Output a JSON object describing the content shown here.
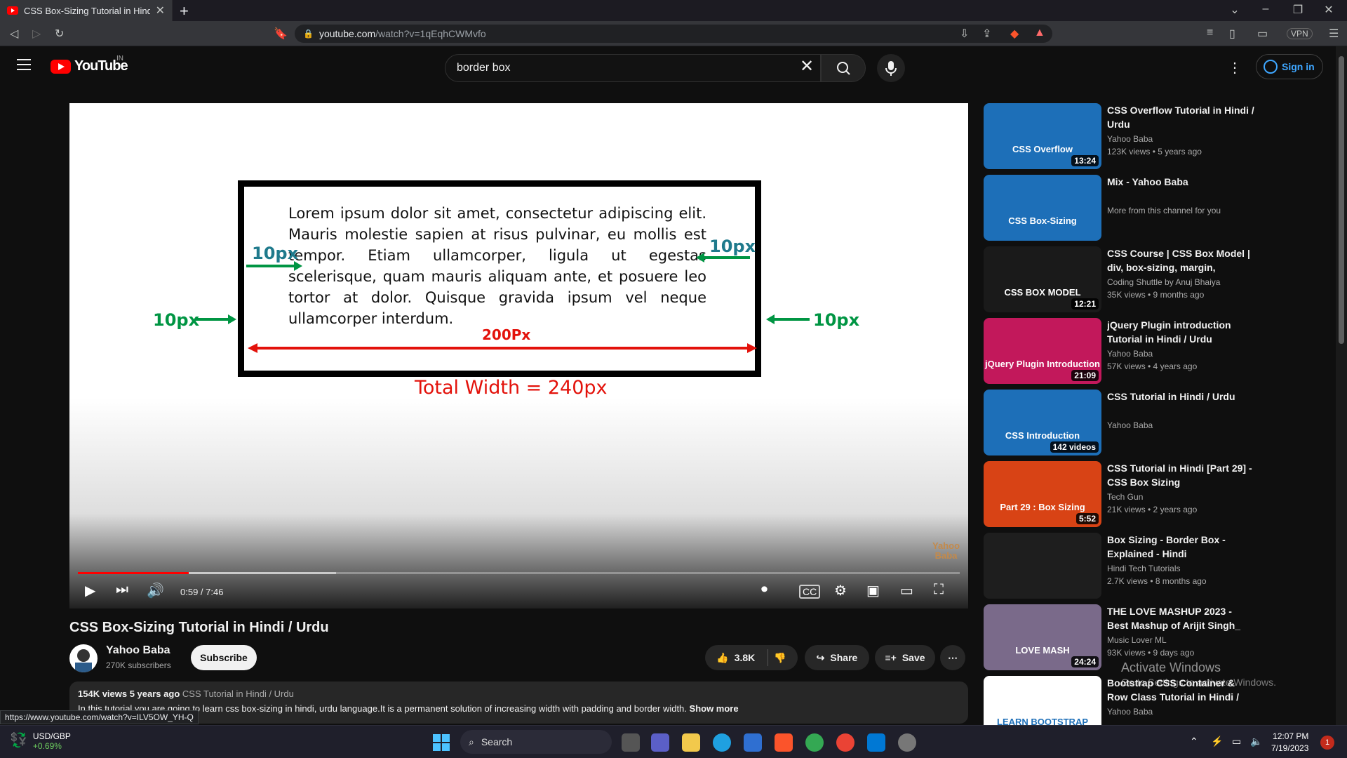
{
  "browser": {
    "tab_title": "CSS Box-Sizing Tutorial in Hindi /",
    "url_host": "youtube.com",
    "url_path": "/watch?v=1qEqhCWMvfo",
    "vpn_label": "VPN",
    "status_url": "https://www.youtube.com/watch?v=ILV5OW_YH-Q"
  },
  "header": {
    "logo_text": "YouTube",
    "country": "IN",
    "search_value": "border box",
    "sign_in": "Sign in"
  },
  "video": {
    "slide": {
      "lorem": "Lorem ipsum dolor sit amet, consectetur adipiscing elit. Mauris molestie sapien at risus pulvinar, eu mollis est tempor. Etiam ullamcorper, ligula ut egestas scelerisque, quam mauris aliquam ante, et posuere leo tortor at dolor. Quisque gravida ipsum vel neque ullamcorper interdum.",
      "label_padding_left": "10px",
      "label_padding_right": "10px",
      "label_border_left": "10px",
      "label_border_right": "10px",
      "label_width": "200Px",
      "total_width": "Total Width = 240px",
      "watermark_1": "Yahoo",
      "watermark_2": "Baba"
    },
    "time": "0:59 / 7:46",
    "progress_played": 0.126,
    "progress_buffered": 0.293,
    "title": "CSS Box-Sizing Tutorial in Hindi / Urdu",
    "channel": "Yahoo Baba",
    "subscribers": "270K subscribers",
    "subscribe_label": "Subscribe",
    "likes": "3.8K",
    "share_label": "Share",
    "save_label": "Save",
    "description": {
      "meta": "154K views  5 years ago",
      "tag": "CSS Tutorial in Hindi / Urdu",
      "text": "In this tutorial you are going to learn css box-sizing in hindi, urdu language.It is a permanent solution of increasing width with padding and border width.",
      "more": "Show more"
    }
  },
  "recommendations": [
    {
      "title": "CSS Overflow Tutorial in Hindi / Urdu",
      "channel": "Yahoo Baba",
      "meta": "123K views  • 5 years ago",
      "duration": "13:24",
      "thumb_text": "CSS Overflow",
      "thumb_color": "#1d6fb8"
    },
    {
      "title": "Mix - Yahoo Baba",
      "channel": "More from this channel for you",
      "meta": "",
      "duration": "",
      "thumb_text": "CSS Box-Sizing",
      "thumb_color": "#1d6fb8"
    },
    {
      "title": "CSS Course | CSS Box Model | div, box-sizing, margin, paddin...",
      "channel": "Coding Shuttle by Anuj Bhaiya",
      "meta": "35K views  • 9 months ago",
      "duration": "12:21",
      "thumb_text": "CSS BOX MODEL",
      "thumb_color": "#1a1a1a"
    },
    {
      "title": "jQuery Plugin introduction Tutorial in Hindi / Urdu",
      "channel": "Yahoo Baba",
      "meta": "57K views  • 4 years ago",
      "duration": "21:09",
      "thumb_text": "jQuery Plugin Introduction",
      "thumb_color": "#c2185b"
    },
    {
      "title": "CSS Tutorial in Hindi / Urdu",
      "channel": "Yahoo Baba",
      "meta": "",
      "duration": "142 videos",
      "thumb_text": "CSS Introduction",
      "thumb_color": "#1d6fb8"
    },
    {
      "title": "CSS Tutorial in Hindi [Part 29] - CSS Box Sizing",
      "channel": "Tech Gun",
      "meta": "21K views  • 2 years ago",
      "duration": "5:52",
      "thumb_text": "Part 29 : Box Sizing",
      "thumb_color": "#d84315"
    },
    {
      "title": "Box Sizing - Border Box - Explained - Hindi",
      "channel": "Hindi Tech Tutorials",
      "meta": "2.7K views  • 8 months ago",
      "duration": "",
      "thumb_text": "",
      "thumb_color": "#1e1e1e"
    },
    {
      "title": "THE LOVE MASHUP 2023 - Best Mashup of Arijit Singh_ Jubin...",
      "channel": "Music Lover ML",
      "meta": "93K views  • 9 days ago",
      "duration": "24:24",
      "thumb_text": "LOVE MASH",
      "thumb_color": "#7a6a8a"
    },
    {
      "title": "Bootstrap CSS Container & Row Class Tutorial in Hindi / Urdu",
      "channel": "Yahoo Baba",
      "meta": "",
      "duration": "",
      "thumb_text": "LEARN BOOTSTRAP",
      "thumb_color": "#ffffff"
    }
  ],
  "os": {
    "activate_title": "Activate Windows",
    "activate_sub": "Go to Settings to activate Windows.",
    "stock_pair": "USD/GBP",
    "stock_change": "+0.69%",
    "search_label": "Search",
    "time": "12:07 PM",
    "date": "7/19/2023",
    "notif_count": "1"
  }
}
